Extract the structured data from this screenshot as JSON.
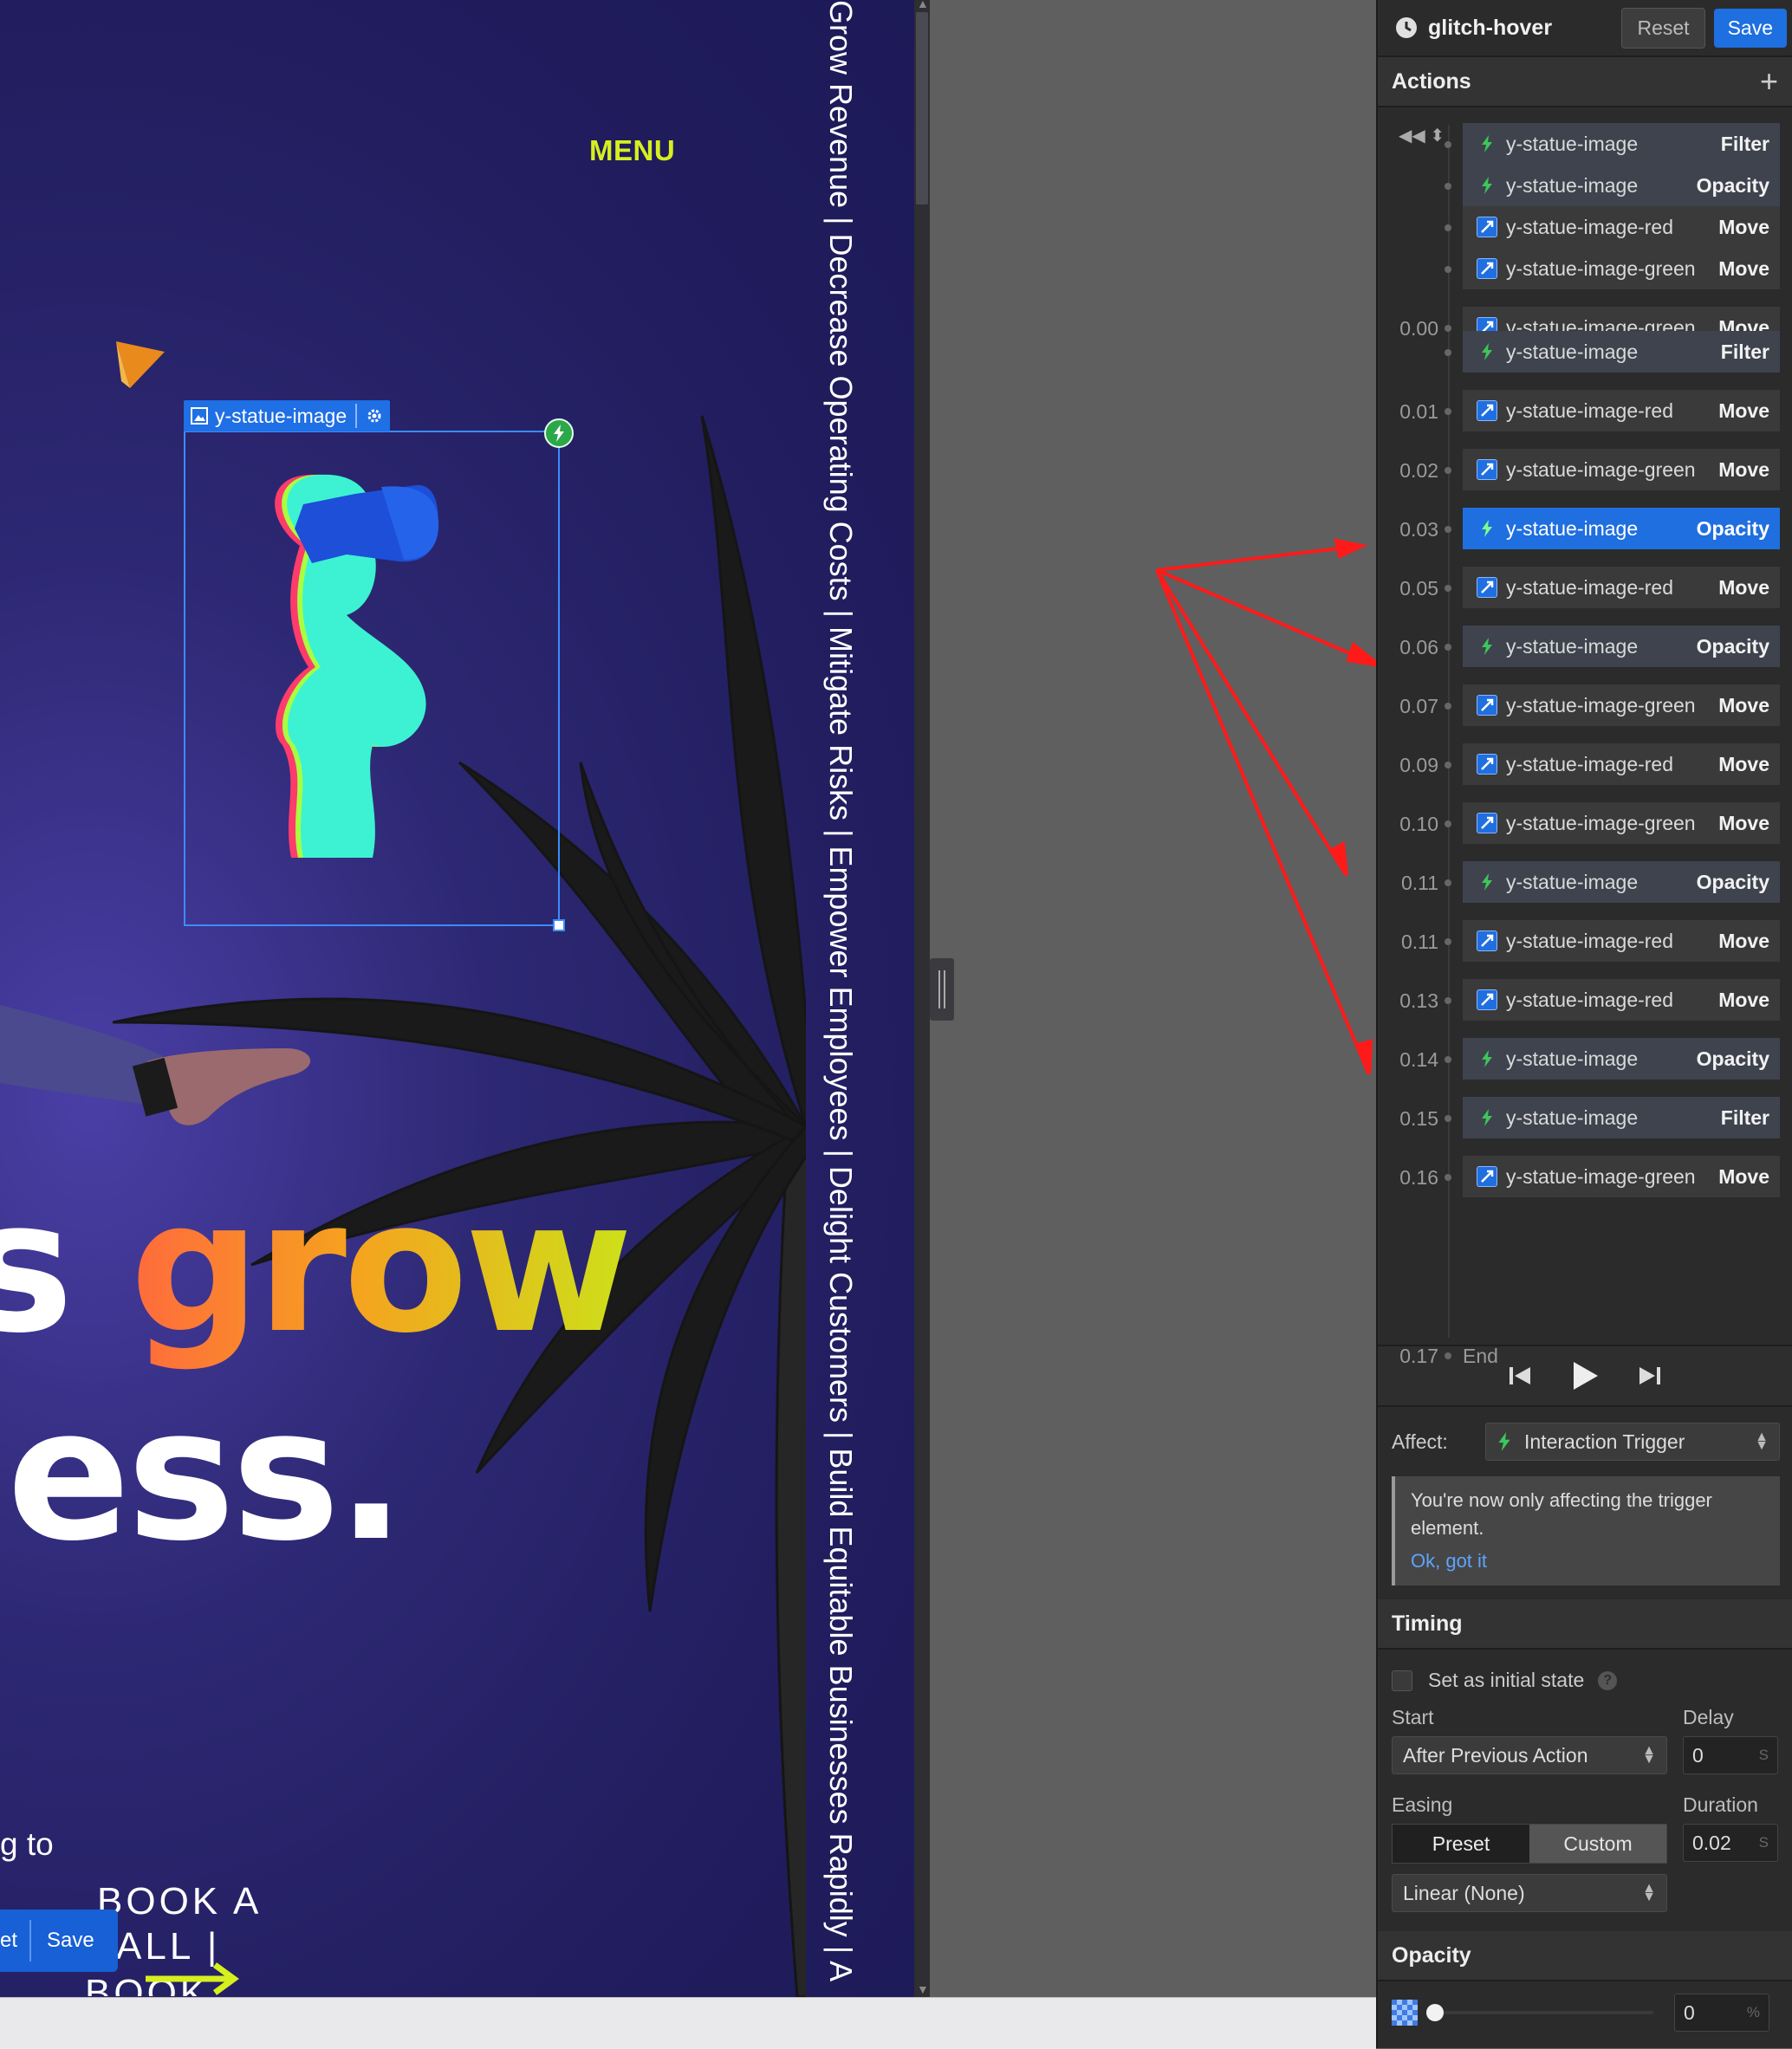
{
  "canvas": {
    "menu_label": "MENU",
    "selection_tag": "y-statue-image",
    "headline_prefix": "s",
    "headline_grad": "grow",
    "headline_line2": "ess.",
    "body_fragment": "g to",
    "cta_line1": "BOOK A",
    "cta_line2": "ALL |",
    "cta_line3": "BOOK",
    "mini_reset": "et",
    "mini_save": "Save",
    "marquee": "Grow Revenue  |  Decrease Operating Costs  |  Mitigate Risks  |  Empower Employees  |  Delight Customers  |  Build Equitable Businesses Rapidly  |  A"
  },
  "panel": {
    "header_title": "glitch-hover",
    "reset_label": "Reset",
    "save_label": "Save",
    "actions_title": "Actions",
    "add_icon": "+",
    "timeline": [
      {
        "time": "",
        "target": "y-statue-image",
        "action": "Filter",
        "icon": "bolt-icon",
        "style": "grp"
      },
      {
        "time": "",
        "target": "y-statue-image",
        "action": "Opacity",
        "icon": "bolt-icon",
        "style": "grp"
      },
      {
        "time": "",
        "target": "y-statue-image-red",
        "action": "Move",
        "icon": "move-icon",
        "style": ""
      },
      {
        "time": "",
        "target": "y-statue-image-green",
        "action": "Move",
        "icon": "move-icon",
        "style": ""
      },
      {
        "time": "0.00",
        "target": "y-statue-image-green",
        "action": "Move",
        "icon": "move-icon",
        "style": ""
      },
      {
        "time": "",
        "target": "y-statue-image",
        "action": "Filter",
        "icon": "bolt-icon",
        "style": "grp"
      },
      {
        "time": "0.01",
        "target": "y-statue-image-red",
        "action": "Move",
        "icon": "move-icon",
        "style": ""
      },
      {
        "time": "0.02",
        "target": "y-statue-image-green",
        "action": "Move",
        "icon": "move-icon",
        "style": ""
      },
      {
        "time": "0.03",
        "target": "y-statue-image",
        "action": "Opacity",
        "icon": "bolt-icon",
        "style": "active"
      },
      {
        "time": "0.05",
        "target": "y-statue-image-red",
        "action": "Move",
        "icon": "move-icon",
        "style": ""
      },
      {
        "time": "0.06",
        "target": "y-statue-image",
        "action": "Opacity",
        "icon": "bolt-icon",
        "style": "grp"
      },
      {
        "time": "0.07",
        "target": "y-statue-image-green",
        "action": "Move",
        "icon": "move-icon",
        "style": ""
      },
      {
        "time": "0.09",
        "target": "y-statue-image-red",
        "action": "Move",
        "icon": "move-icon",
        "style": ""
      },
      {
        "time": "0.10",
        "target": "y-statue-image-green",
        "action": "Move",
        "icon": "move-icon",
        "style": ""
      },
      {
        "time": "0.11",
        "target": "y-statue-image",
        "action": "Opacity",
        "icon": "bolt-icon",
        "style": "grp"
      },
      {
        "time": "0.11",
        "target": "y-statue-image-red",
        "action": "Move",
        "icon": "move-icon",
        "style": ""
      },
      {
        "time": "0.13",
        "target": "y-statue-image-red",
        "action": "Move",
        "icon": "move-icon",
        "style": ""
      },
      {
        "time": "0.14",
        "target": "y-statue-image",
        "action": "Opacity",
        "icon": "bolt-icon",
        "style": "grp"
      },
      {
        "time": "0.15",
        "target": "y-statue-image",
        "action": "Filter",
        "icon": "bolt-icon",
        "style": "grp"
      },
      {
        "time": "0.16",
        "target": "y-statue-image-green",
        "action": "Move",
        "icon": "move-icon",
        "style": ""
      }
    ],
    "end_time": "0.17",
    "end_label": "End",
    "affect_label": "Affect:",
    "affect_value": "Interaction Trigger",
    "notice_text": "You're now only affecting the trigger element.",
    "notice_link": "Ok, got it",
    "timing_title": "Timing",
    "initial_state_label": "Set as initial state",
    "start_label": "Start",
    "start_value": "After Previous Action",
    "delay_label": "Delay",
    "delay_value": "0",
    "delay_unit": "S",
    "easing_label": "Easing",
    "preset_label": "Preset",
    "custom_label": "Custom",
    "duration_label": "Duration",
    "duration_value": "0.02",
    "duration_unit": "S",
    "easing_value": "Linear (None)",
    "opacity_title": "Opacity",
    "opacity_value": "0",
    "opacity_unit": "%",
    "opacity_level": 0
  },
  "colors": {
    "accent_blue": "#1f6fe0",
    "bolt_green": "#2aa84a",
    "menu_lime": "#d6f01e",
    "annotation_red": "#ff1a1a"
  }
}
